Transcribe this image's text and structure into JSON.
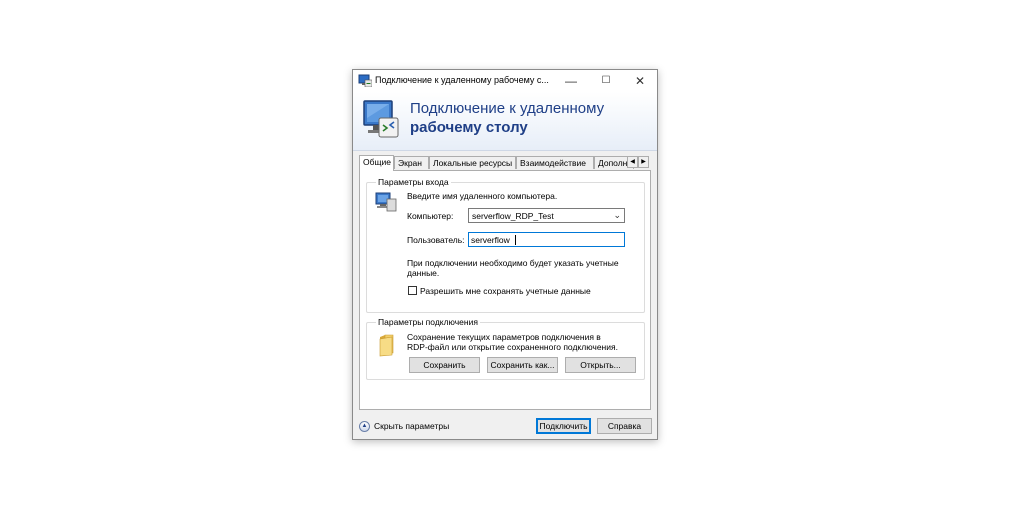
{
  "window": {
    "title": "Подключение к удаленному рабочему с...",
    "minimize_glyph": "—",
    "maximize_glyph": "☐",
    "close_glyph": "✕"
  },
  "banner": {
    "line1": "Подключение к удаленному",
    "line2": "рабочему столу"
  },
  "tabs": [
    "Общие",
    "Экран",
    "Локальные ресурсы",
    "Взаимодействие",
    "Дополни"
  ],
  "tab_scroll": {
    "left": "◀",
    "right": "▶"
  },
  "login_group": {
    "title": "Параметры входа",
    "hint": "Введите имя удаленного компьютера.",
    "computer_label": "Компьютер:",
    "computer_value": "serverflow_RDP_Test",
    "user_label": "Пользователь:",
    "user_value": "serverflow",
    "note_line1": "При подключении необходимо будет указать учетные",
    "note_line2": "данные.",
    "save_credentials_label": "Разрешить мне сохранять учетные данные",
    "save_credentials_checked": false
  },
  "connection_group": {
    "title": "Параметры подключения",
    "desc_line1": "Сохранение текущих параметров подключения в",
    "desc_line2": "RDP-файл или открытие сохраненного подключения.",
    "save_button": "Сохранить",
    "save_as_button": "Сохранить как...",
    "open_button": "Открыть..."
  },
  "footer": {
    "hide_options": "Скрыть параметры",
    "connect_button": "Подключить",
    "help_button": "Справка"
  },
  "colors": {
    "banner_text": "#1f3f87",
    "focus_border": "#0078d7"
  },
  "icons": [
    "rdp-app-icon",
    "monitor-icon",
    "folder-icon",
    "chevron-up-icon"
  ]
}
